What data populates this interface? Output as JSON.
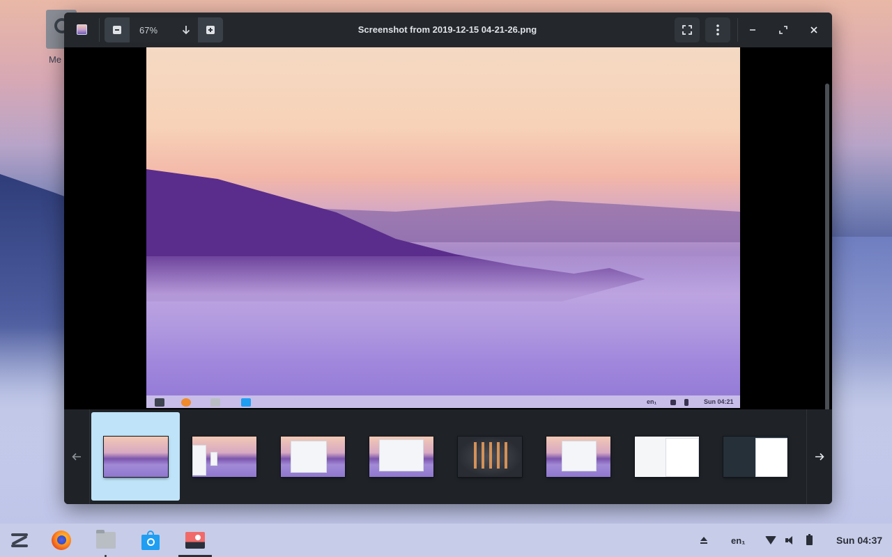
{
  "desktop": {
    "icon_label": "Me"
  },
  "window": {
    "title": "Screenshot from 2019-12-15 04-21-26.png",
    "zoom_value": "67%"
  },
  "photo_panel": {
    "lang": "en₁",
    "clock": "Sun 04:21"
  },
  "thumbnails": {
    "count": 8,
    "active_index": 0
  },
  "taskbar": {
    "apps": [
      "zorin-menu",
      "firefox",
      "files",
      "software",
      "image-viewer"
    ],
    "lang": "en₁",
    "clock": "Sun 04:37"
  }
}
